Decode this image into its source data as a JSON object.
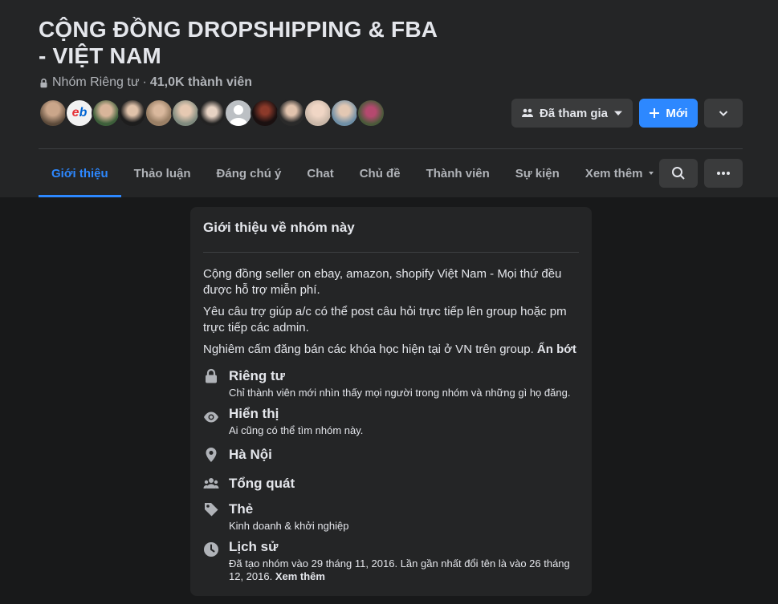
{
  "group": {
    "title": "CỘNG ĐỒNG DROPSHIPPING & FBA - VIỆT NAM",
    "privacy": "Nhóm Riêng tư",
    "separator": "·",
    "members": "41,0K thành viên"
  },
  "actions": {
    "joined_label": "Đã tham gia",
    "new_label": "Mới"
  },
  "tabs": [
    {
      "label": "Giới thiệu",
      "active": true
    },
    {
      "label": "Thảo luận"
    },
    {
      "label": "Đáng chú ý"
    },
    {
      "label": "Chat"
    },
    {
      "label": "Chủ đề"
    },
    {
      "label": "Thành viên"
    },
    {
      "label": "Sự kiện"
    },
    {
      "label": "Xem thêm"
    }
  ],
  "about": {
    "title": "Giới thiệu về nhóm này",
    "paragraphs": [
      "Cộng đồng seller on ebay, amazon, shopify Việt Nam - Mọi thứ đều được hỗ trợ miễn phí.",
      "Yêu câu trợ giúp a/c có thể post câu hỏi trực tiếp lên group hoặc pm trực tiếp các admin.",
      "Nghiêm cấm đăng bán các khóa học hiện tại ở VN trên group."
    ],
    "collapse_label": "Ẩn bớt",
    "items": [
      {
        "icon": "lock-icon",
        "title": "Riêng tư",
        "sub": "Chỉ thành viên mới nhìn thấy mọi người trong nhóm và những gì họ đăng."
      },
      {
        "icon": "eye-icon",
        "title": "Hiển thị",
        "sub": "Ai cũng có thể tìm nhóm này."
      },
      {
        "icon": "location-pin-icon",
        "title": "Hà Nội",
        "sub": ""
      },
      {
        "icon": "people-icon",
        "title": "Tổng quát",
        "sub": ""
      },
      {
        "icon": "tag-icon",
        "title": "Thẻ",
        "sub": "Kinh doanh & khởi nghiệp"
      },
      {
        "icon": "clock-icon",
        "title": "Lịch sử",
        "sub": "Đã tạo nhóm vào 29 tháng 11, 2016. Lần gần nhất đổi tên là vào 26 tháng 12, 2016."
      }
    ],
    "history_more_label": "Xem thêm"
  },
  "colors": {
    "accent": "#2d88ff",
    "background": "#18191a",
    "surface": "#242526",
    "button": "#3a3b3c"
  }
}
